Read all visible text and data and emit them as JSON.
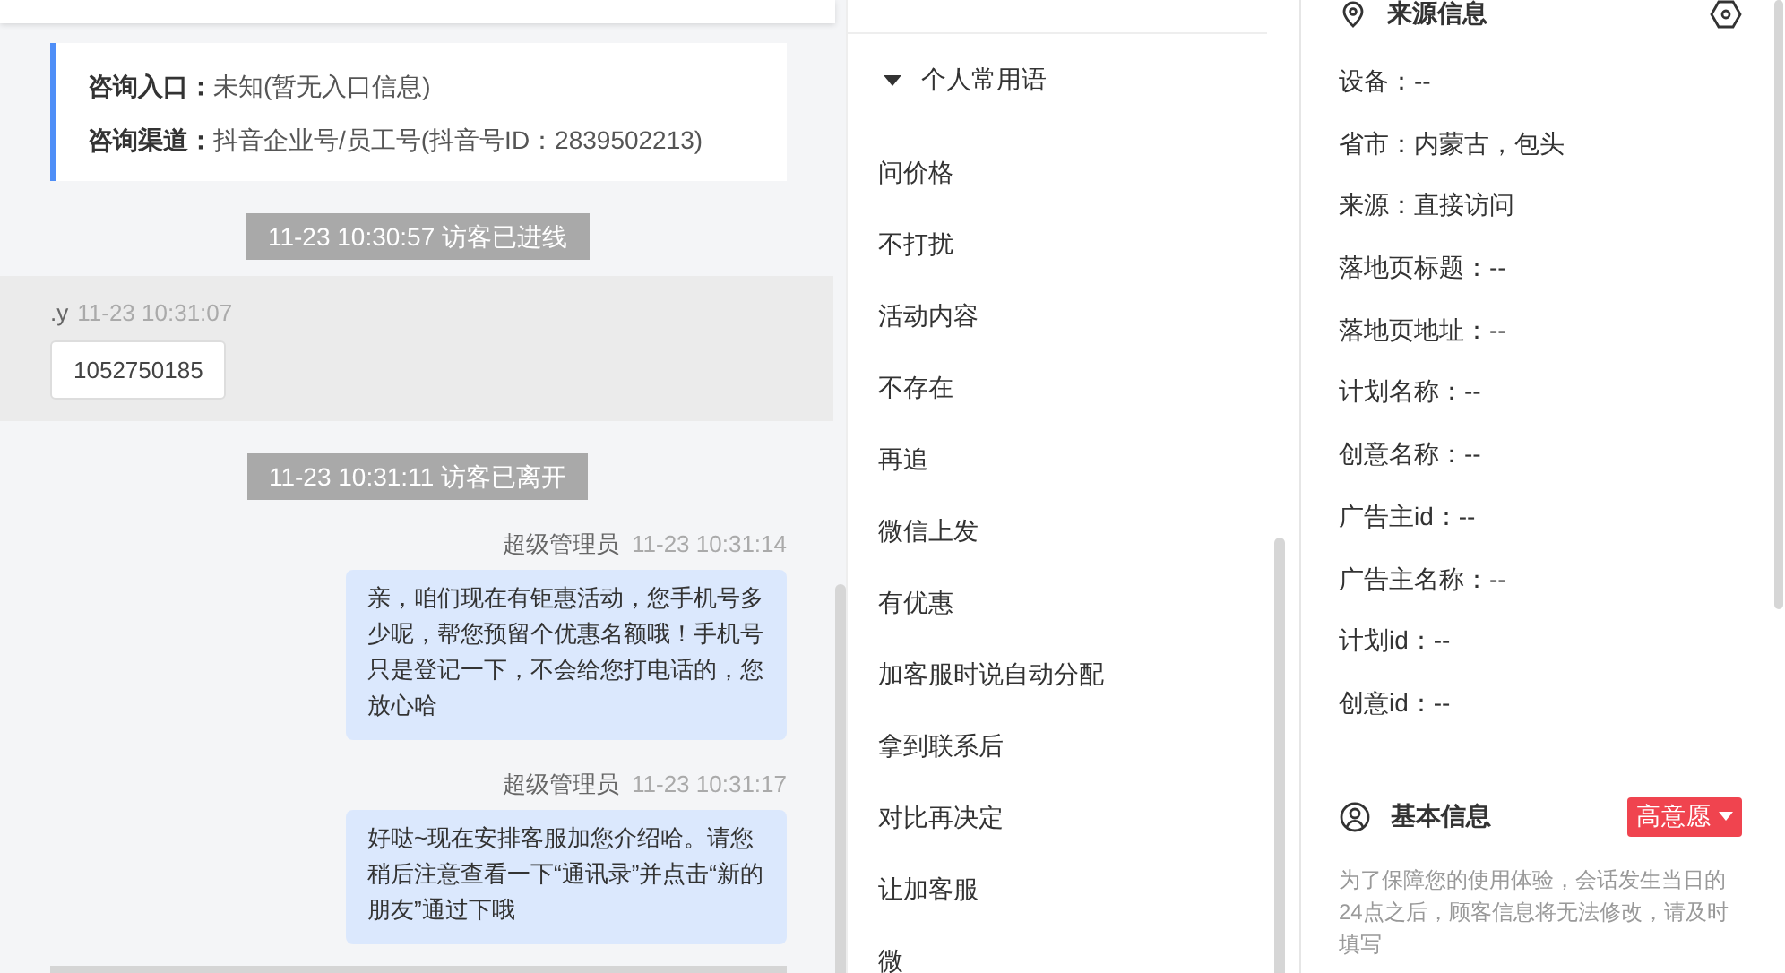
{
  "consult_info": [
    {
      "label": "咨询入口：",
      "value": "未知(暂无入口信息)"
    },
    {
      "label": "咨询渠道：",
      "value": "抖音企业号/员工号(抖音号ID：2839502213)"
    }
  ],
  "messages": [
    {
      "kind": "system",
      "text": "11-23 10:30:57 访客已进线"
    },
    {
      "kind": "visitor",
      "sender": ".y",
      "time": "11-23 10:31:07",
      "text": "1052750185"
    },
    {
      "kind": "system",
      "text": "11-23 10:31:11 访客已离开"
    },
    {
      "kind": "agent",
      "sender": "超级管理员",
      "time": "11-23 10:31:14",
      "text": "亲，咱们现在有钜惠活动，您手机号多少呢，帮您预留个优惠名额哦！手机号只是登记一下，不会给您打电话的，您放心哈"
    },
    {
      "kind": "agent",
      "sender": "超级管理员",
      "time": "11-23 10:31:17",
      "text": "好哒~现在安排客服加您介绍哈。请您稍后注意查看一下“通讯录”并点击“新的朋友”通过下哦"
    },
    {
      "kind": "system_cut"
    }
  ],
  "phrases": {
    "title": "个人常用语",
    "expanded": true,
    "items": [
      "问价格",
      "不打扰",
      "活动内容",
      "不存在",
      "再追",
      "微信上发",
      "有优惠",
      "加客服时说自动分配",
      "拿到联系后",
      "对比再决定",
      "让加客服",
      "微"
    ]
  },
  "source_info": {
    "title": "来源信息",
    "rows": [
      "设备：--",
      "省市：内蒙古，包头",
      "来源：直接访问",
      "落地页标题：--",
      "落地页地址：--",
      "计划名称：--",
      "创意名称：--",
      "广告主id：--",
      "广告主名称：--",
      "计划id：--",
      "创意id：--"
    ]
  },
  "basic_info": {
    "title": "基本信息",
    "intent_tag": "高意愿",
    "note": "为了保障您的使用体验，会话发生当日的24点之后，顾客信息将无法修改，请及时填写"
  }
}
